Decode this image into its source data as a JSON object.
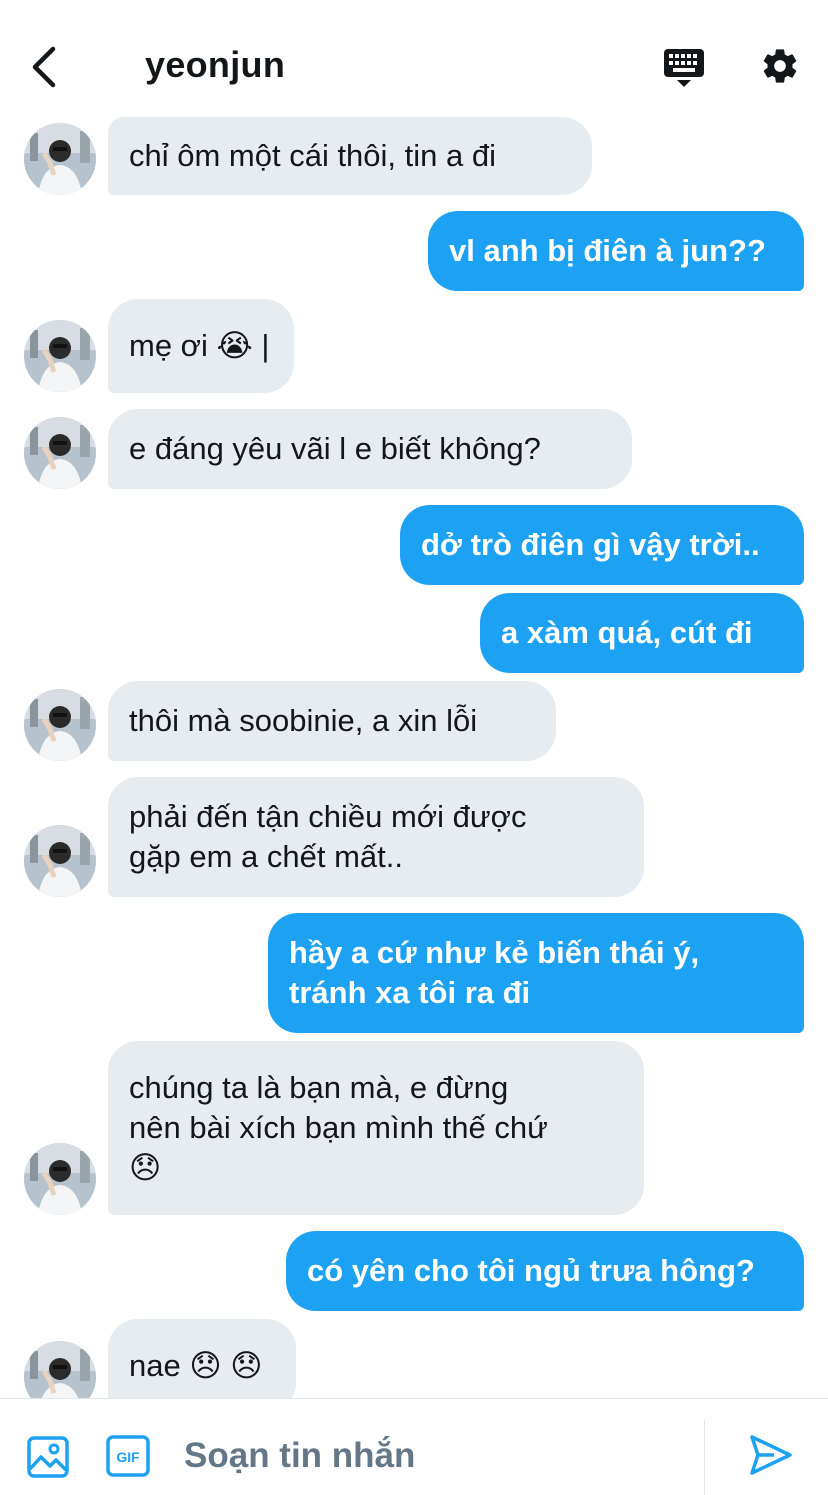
{
  "header": {
    "title": "yeonjun"
  },
  "icons": {
    "back": "chevron-left-icon",
    "keyboard": "keyboard-icon",
    "settings": "gear-icon",
    "image": "image-icon",
    "gif": "gif-icon",
    "send": "send-icon"
  },
  "colors": {
    "accent": "#1da1f2",
    "incoming_bubble": "#e6ecf0",
    "text": "#14171a",
    "muted": "#657786"
  },
  "messages": [
    {
      "from": "them",
      "text": "chỉ ôm một cái thôi, tin a đi"
    },
    {
      "from": "me",
      "text": "vl anh bị điên à jun??"
    },
    {
      "from": "them",
      "text": "mẹ ơi 😭 |"
    },
    {
      "from": "them",
      "text": "e đáng yêu vãi l e biết không?"
    },
    {
      "from": "me",
      "text": "dở trò điên gì vậy trời.."
    },
    {
      "from": "me",
      "text": "a xàm quá, cút đi"
    },
    {
      "from": "them",
      "text": "thôi mà soobinie, a xin lỗi"
    },
    {
      "from": "them",
      "text": "phải đến tận chiều mới được\ngặp em a chết mất.."
    },
    {
      "from": "me",
      "text": "hầy a cứ như kẻ biến thái ý,\ntránh xa tôi ra đi"
    },
    {
      "from": "them",
      "text": "chúng ta là bạn mà, e đừng\nnên bài xích bạn mình thế chứ\n😞"
    },
    {
      "from": "me",
      "text": "có yên cho tôi ngủ trưa hông?"
    },
    {
      "from": "them",
      "text": "nae 😞 😞"
    }
  ],
  "composer": {
    "placeholder": "Soạn tin nhắn",
    "gif_label": "GIF"
  }
}
